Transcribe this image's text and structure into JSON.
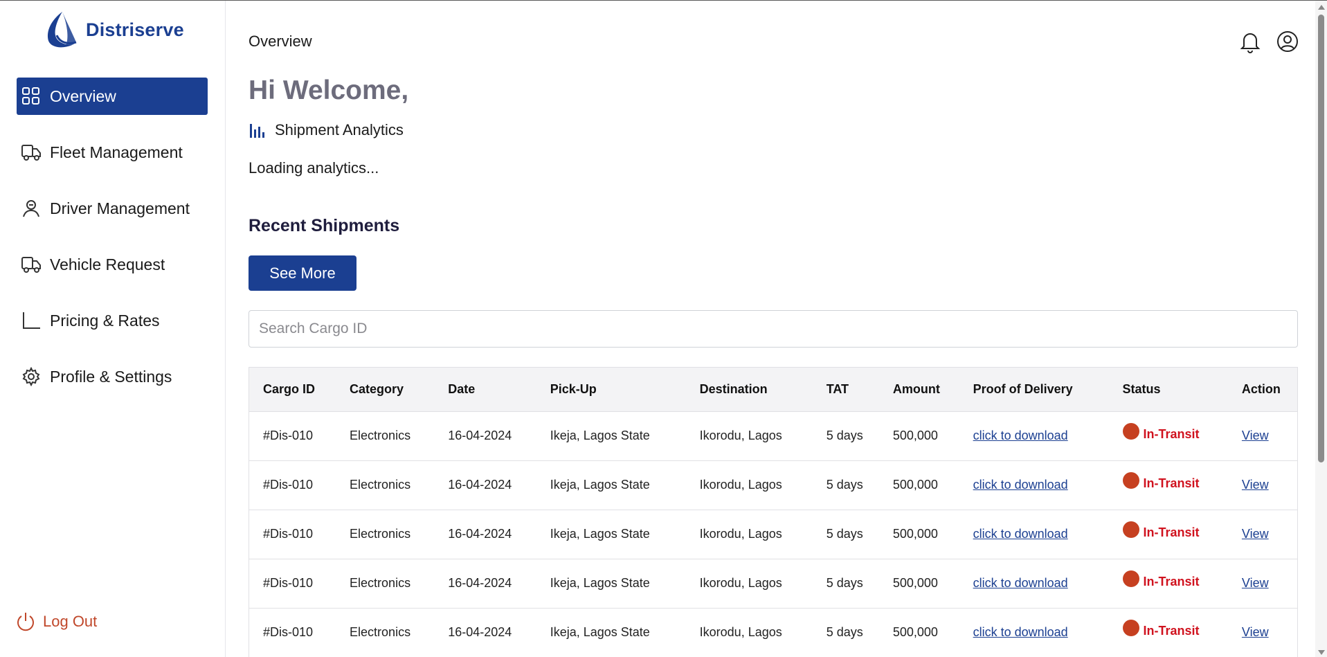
{
  "brand": {
    "name": "Distriserve",
    "color": "#1b3f91"
  },
  "sidebar": {
    "items": [
      {
        "label": "Overview",
        "icon": "grid-icon",
        "active": true
      },
      {
        "label": "Fleet Management",
        "icon": "truck-icon"
      },
      {
        "label": "Driver Management",
        "icon": "driver-icon"
      },
      {
        "label": "Vehicle Request",
        "icon": "truck-icon"
      },
      {
        "label": "Pricing & Rates",
        "icon": "axis-icon"
      },
      {
        "label": "Profile & Settings",
        "icon": "gear-icon"
      }
    ],
    "logout_label": "Log Out"
  },
  "header": {
    "title": "Overview"
  },
  "main": {
    "welcome": "Hi Welcome,",
    "analytics_heading": "Shipment Analytics",
    "loading_text": "Loading analytics...",
    "recent_heading": "Recent Shipments",
    "see_more_label": "See More",
    "search_placeholder": "Search Cargo ID"
  },
  "table": {
    "columns": [
      "Cargo ID",
      "Category",
      "Date",
      "Pick-Up",
      "Destination",
      "TAT",
      "Amount",
      "Proof of Delivery",
      "Status",
      "Action"
    ],
    "rows": [
      {
        "cargo_id": "#Dis-010",
        "category": "Electronics",
        "date": "16-04-2024",
        "pickup": "Ikeja, Lagos State",
        "destination": "Ikorodu, Lagos",
        "tat": "5 days",
        "amount": "500,000",
        "proof": "click to download",
        "status": "In-Transit",
        "action": "View"
      },
      {
        "cargo_id": "#Dis-010",
        "category": "Electronics",
        "date": "16-04-2024",
        "pickup": "Ikeja, Lagos State",
        "destination": "Ikorodu, Lagos",
        "tat": "5 days",
        "amount": "500,000",
        "proof": "click to download",
        "status": "In-Transit",
        "action": "View"
      },
      {
        "cargo_id": "#Dis-010",
        "category": "Electronics",
        "date": "16-04-2024",
        "pickup": "Ikeja, Lagos State",
        "destination": "Ikorodu, Lagos",
        "tat": "5 days",
        "amount": "500,000",
        "proof": "click to download",
        "status": "In-Transit",
        "action": "View"
      },
      {
        "cargo_id": "#Dis-010",
        "category": "Electronics",
        "date": "16-04-2024",
        "pickup": "Ikeja, Lagos State",
        "destination": "Ikorodu, Lagos",
        "tat": "5 days",
        "amount": "500,000",
        "proof": "click to download",
        "status": "In-Transit",
        "action": "View"
      },
      {
        "cargo_id": "#Dis-010",
        "category": "Electronics",
        "date": "16-04-2024",
        "pickup": "Ikeja, Lagos State",
        "destination": "Ikorodu, Lagos",
        "tat": "5 days",
        "amount": "500,000",
        "proof": "click to download",
        "status": "In-Transit",
        "action": "View"
      }
    ]
  },
  "colors": {
    "accent": "#1b3f91",
    "status_dot": "#c64020",
    "status_text": "#d0121e",
    "logout": "#c0472a"
  }
}
